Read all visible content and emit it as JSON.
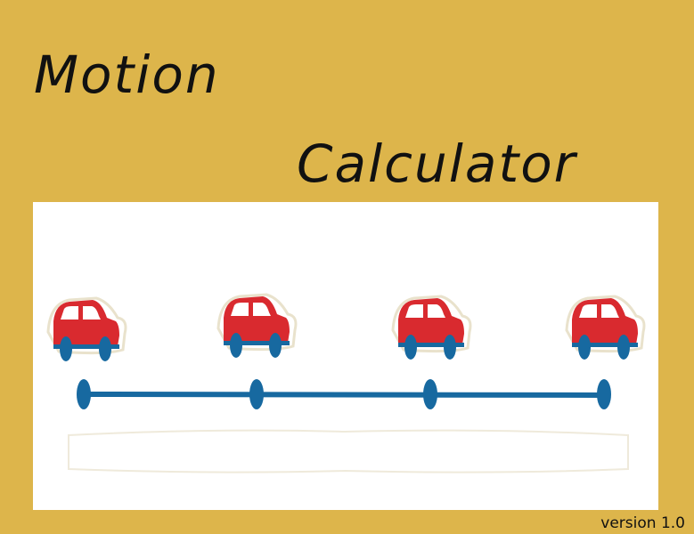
{
  "app": {
    "title_line1": "Motion",
    "title_line2": "Calculator",
    "version": "version 1.0"
  },
  "illustration": {
    "car_icon": "red-car-icon",
    "car_count": 4,
    "timeline_markers": 4,
    "colors": {
      "background": "#DDB54B",
      "panel": "#FFFFFF",
      "car_body": "#D92A2F",
      "car_window": "#FFFFFF",
      "wheel": "#1769A0",
      "timeline": "#1769A0"
    }
  }
}
